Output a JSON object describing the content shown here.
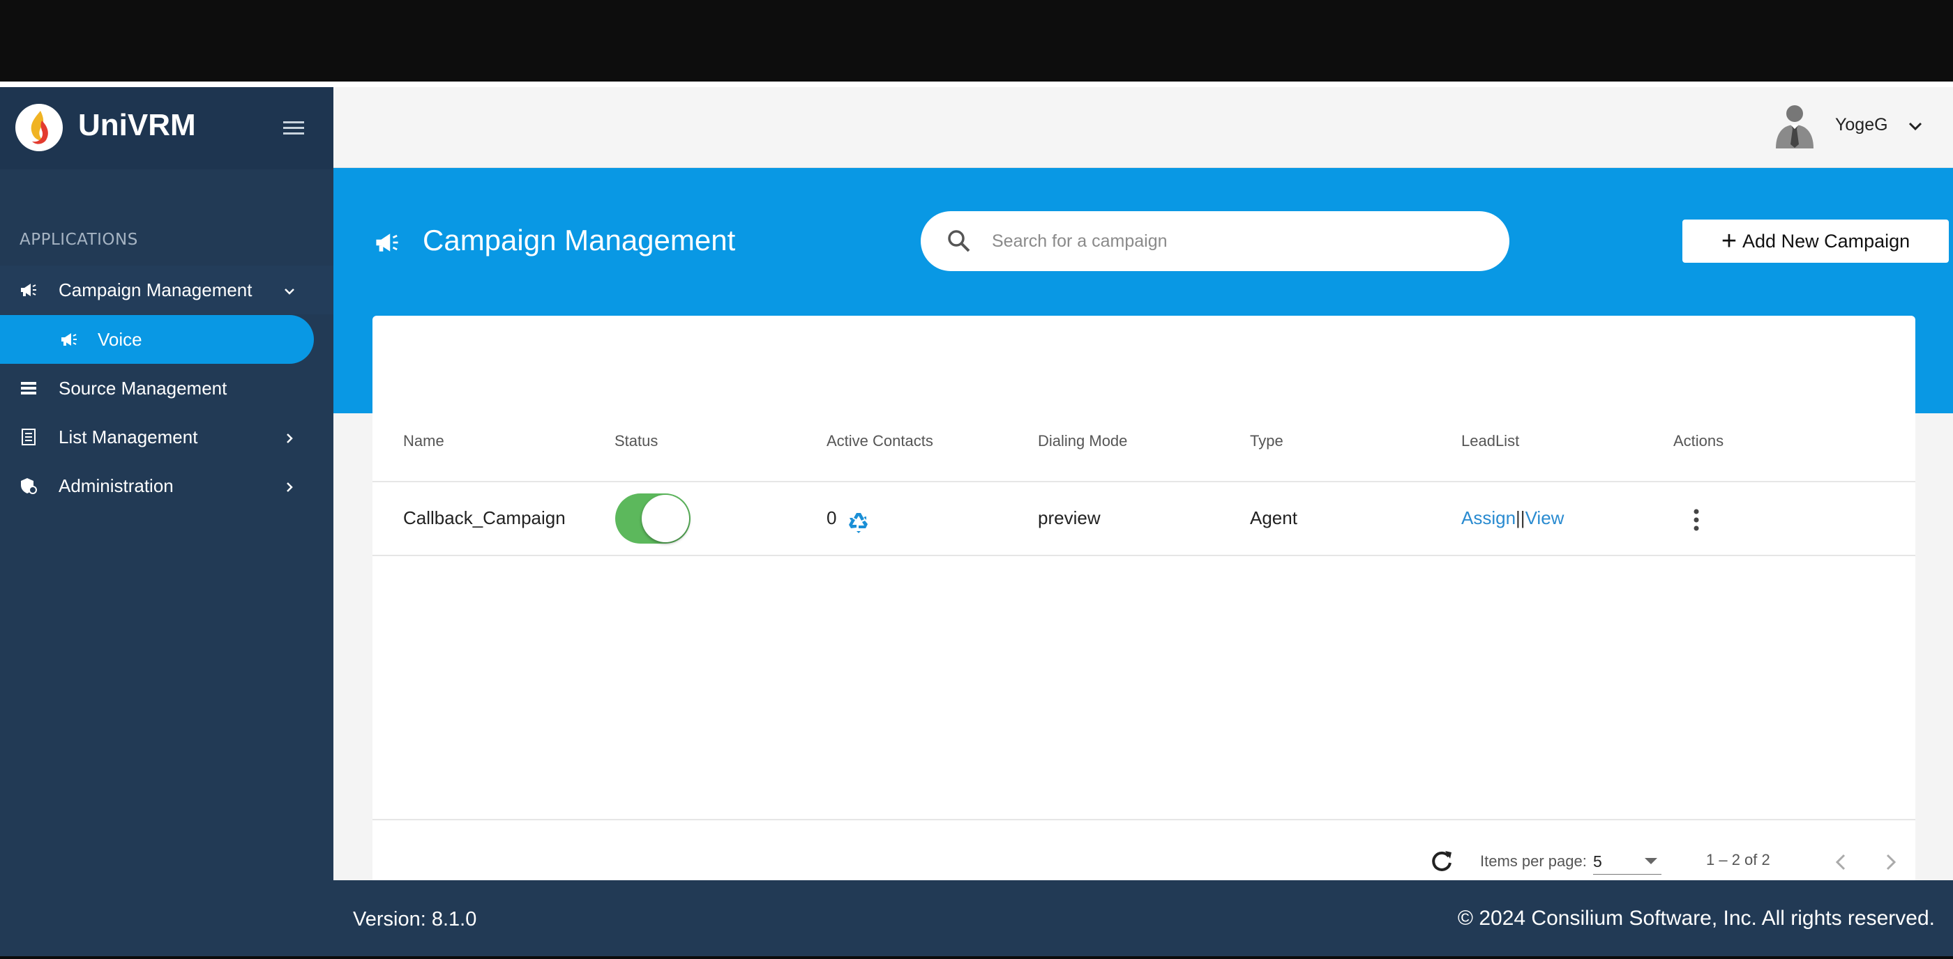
{
  "brand": {
    "name": "UniVRM",
    "logo_icon": "flame-logo-icon"
  },
  "sidebar": {
    "section_label": "APPLICATIONS",
    "items": [
      {
        "label": "Campaign Management",
        "icon": "megaphone-icon",
        "expanded": true
      },
      {
        "label": "Voice",
        "icon": "megaphone-icon",
        "active": true
      },
      {
        "label": "Source Management",
        "icon": "list-icon"
      },
      {
        "label": "List Management",
        "icon": "document-list-icon"
      },
      {
        "label": "Administration",
        "icon": "shield-gear-icon"
      }
    ]
  },
  "header": {
    "username": "YogeG"
  },
  "banner": {
    "title": "Campaign Management",
    "search_placeholder": "Search for a campaign",
    "add_button_label": "Add New Campaign"
  },
  "table": {
    "columns": [
      "Name",
      "Status",
      "Active Contacts",
      "Dialing Mode",
      "Type",
      "LeadList",
      "Actions"
    ],
    "rows": [
      {
        "name": "Callback_Campaign",
        "status_on": true,
        "active_contacts": "0",
        "dialing_mode": "preview",
        "type": "Agent",
        "leadlist_assign": "Assign",
        "leadlist_separator": "||",
        "leadlist_view": "View"
      }
    ]
  },
  "paginator": {
    "items_per_page_label": "Items per page:",
    "items_per_page_value": "5",
    "range_label": "1 – 2 of 2"
  },
  "footer": {
    "version": "Version: 8.1.0",
    "copyright": "© 2024 Consilium Software, Inc. All rights reserved."
  },
  "colors": {
    "sidebar": "#223a55",
    "accent": "#0998e4",
    "toggle_on": "#5cb85c",
    "link": "#2a8bd0"
  }
}
